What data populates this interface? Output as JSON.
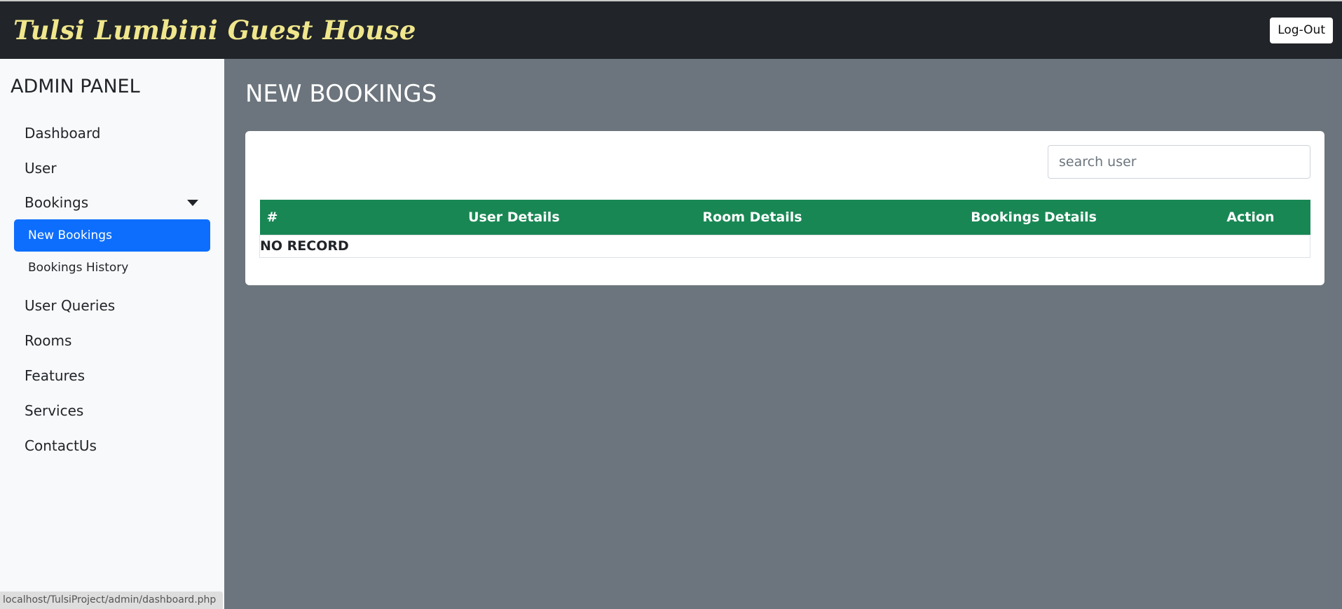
{
  "header": {
    "brand": "Tulsi Lumbini Guest House",
    "logout_label": "Log-Out"
  },
  "sidebar": {
    "title": "ADMIN PANEL",
    "items": [
      {
        "label": "Dashboard"
      },
      {
        "label": "User"
      },
      {
        "label": "Bookings"
      },
      {
        "label": "User Queries"
      },
      {
        "label": "Rooms"
      },
      {
        "label": "Features"
      },
      {
        "label": "Services"
      },
      {
        "label": "ContactUs"
      }
    ],
    "bookings_sub": [
      {
        "label": "New Bookings",
        "active": true
      },
      {
        "label": "Bookings History",
        "active": false
      }
    ]
  },
  "main": {
    "title": "NEW BOOKINGS",
    "search": {
      "placeholder": "search user",
      "value": ""
    },
    "table": {
      "columns": [
        "#",
        "User Details",
        "Room Details",
        "Bookings Details",
        "Action"
      ],
      "empty_message": "NO RECORD"
    }
  },
  "status_bar": {
    "url": "localhost/TulsiProject/admin/dashboard.php"
  },
  "colors": {
    "header_bg": "#212529",
    "brand_color": "#f0e68c",
    "active_item": "#0d6efd",
    "table_header": "#198754",
    "main_bg": "#6c757d"
  }
}
